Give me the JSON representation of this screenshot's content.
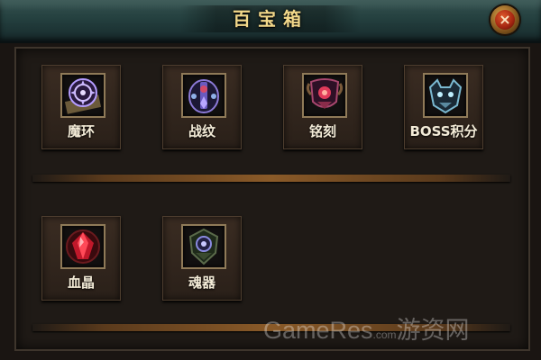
{
  "window": {
    "title": "百宝箱",
    "close_label": "×"
  },
  "items": [
    {
      "label": "魔环",
      "icon": "demon-ring-icon",
      "color": "#8a6ad0"
    },
    {
      "label": "战纹",
      "icon": "battle-pattern-icon",
      "color": "#7a56c8"
    },
    {
      "label": "铭刻",
      "icon": "inscription-icon",
      "color": "#c0306a"
    },
    {
      "label": "BOSS积分",
      "icon": "boss-points-icon",
      "color": "#6ab0c8"
    },
    {
      "label": "血晶",
      "icon": "blood-crystal-icon",
      "color": "#d0202e"
    },
    {
      "label": "魂器",
      "icon": "soul-vessel-icon",
      "color": "#6a6ac8"
    }
  ],
  "watermark": {
    "logo": "GameRes",
    "suffix": "游资网",
    "domain": ".com"
  }
}
